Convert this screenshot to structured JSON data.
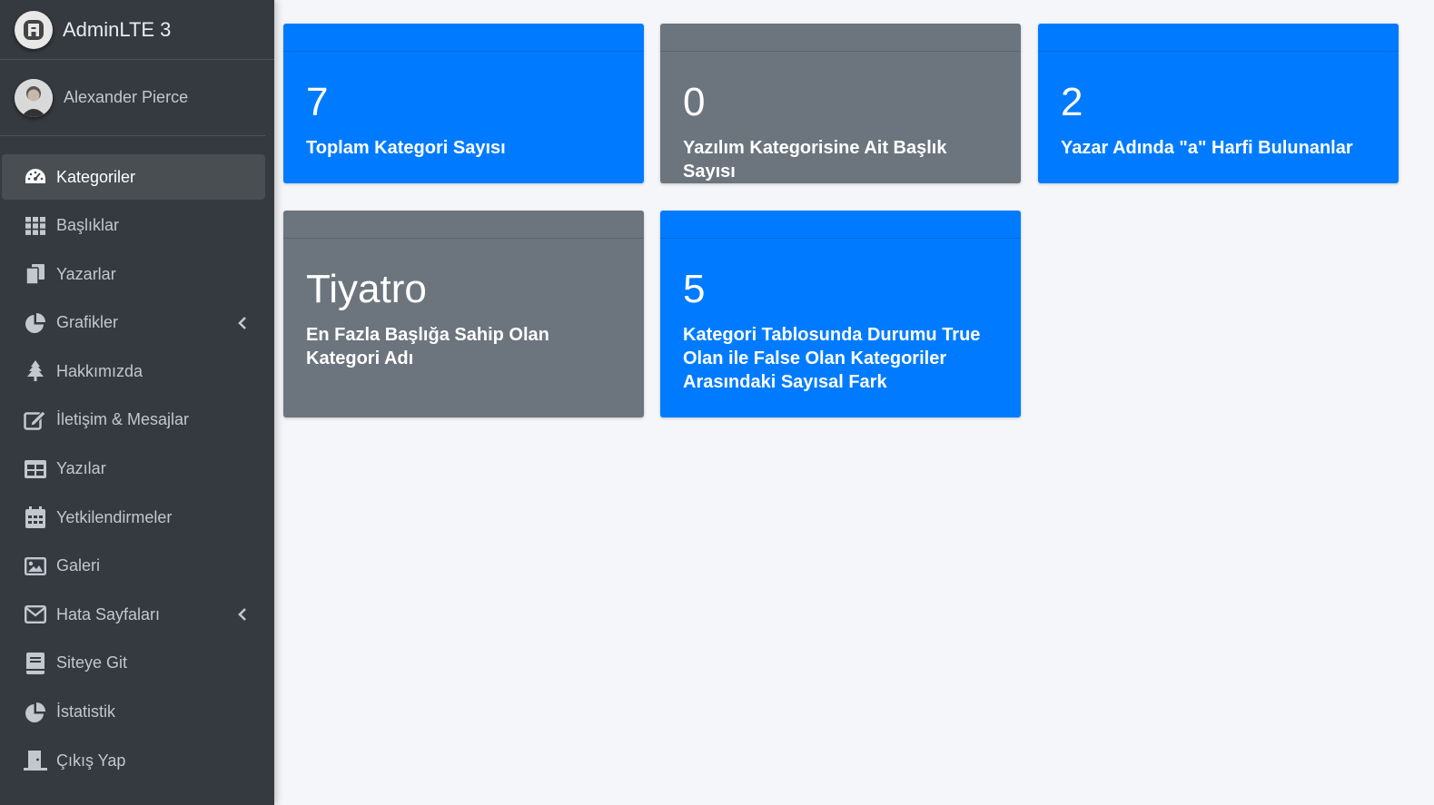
{
  "brand": {
    "name": "AdminLTE 3",
    "icon": "adminlte-logo-icon"
  },
  "user": {
    "name": "Alexander Pierce"
  },
  "sidebar": {
    "items": [
      {
        "label": "Kategoriler",
        "icon": "dashboard-icon",
        "active": true
      },
      {
        "label": "Başlıklar",
        "icon": "grid-icon"
      },
      {
        "label": "Yazarlar",
        "icon": "copy-icon"
      },
      {
        "label": "Grafikler",
        "icon": "pie-chart-icon",
        "submenu": true
      },
      {
        "label": "Hakkımızda",
        "icon": "tree-icon"
      },
      {
        "label": "İletişim & Mesajlar",
        "icon": "edit-icon"
      },
      {
        "label": "Yazılar",
        "icon": "table-icon"
      },
      {
        "label": "Yetkilendirmeler",
        "icon": "calendar-icon"
      },
      {
        "label": "Galeri",
        "icon": "image-icon"
      },
      {
        "label": "Hata Sayfaları",
        "icon": "envelope-icon",
        "submenu": true
      },
      {
        "label": "Siteye Git",
        "icon": "book-icon"
      },
      {
        "label": "İstatistik",
        "icon": "pie-chart-icon"
      },
      {
        "label": "Çıkış Yap",
        "icon": "door-icon"
      }
    ]
  },
  "stats": [
    {
      "value": "7",
      "label": "Toplam Kategori Sayısı",
      "color": "#007bff"
    },
    {
      "value": "0",
      "label": "Yazılım Kategorisine Ait Başlık Sayısı",
      "color": "#6c757d"
    },
    {
      "value": "2",
      "label": "Yazar Adında \"a\" Harfi Bulunanlar",
      "color": "#007bff"
    },
    {
      "value": "Tiyatro",
      "label": "En Fazla Başlığa Sahip Olan Kategori Adı",
      "color": "#6c757d"
    },
    {
      "value": "5",
      "label": "Kategori Tablosunda Durumu True Olan ile False Olan Kategoriler Arasındaki Sayısal Fark",
      "color": "#007bff"
    }
  ],
  "colors": {
    "sidebar": "#343a40",
    "primary": "#007bff",
    "secondary": "#6c757d",
    "background": "#f4f6f9"
  }
}
